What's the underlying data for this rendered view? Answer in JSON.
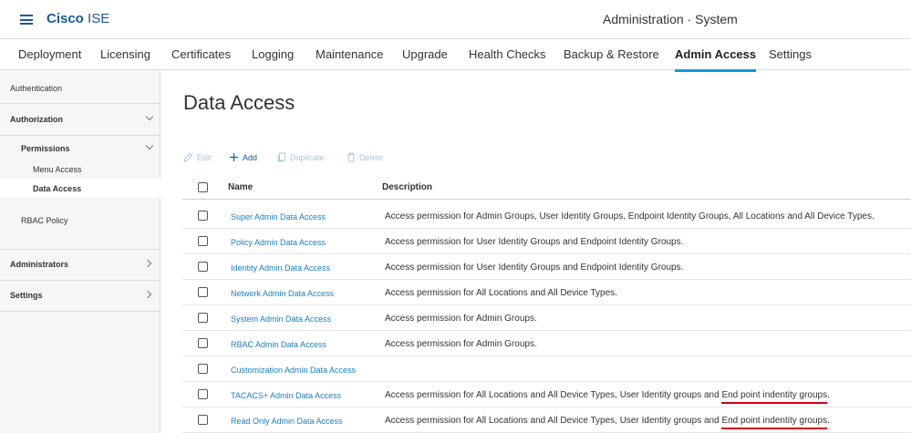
{
  "header": {
    "brand_bold": "Cisco",
    "brand_rest": "ISE",
    "title": "Administration · System"
  },
  "tabs": [
    {
      "label": "Deployment"
    },
    {
      "label": "Licensing"
    },
    {
      "label": "Certificates"
    },
    {
      "label": "Logging"
    },
    {
      "label": "Maintenance"
    },
    {
      "label": "Upgrade"
    },
    {
      "label": "Health Checks"
    },
    {
      "label": "Backup & Restore"
    },
    {
      "label": "Admin Access",
      "active": true
    },
    {
      "label": "Settings"
    }
  ],
  "sidebar": {
    "items": [
      {
        "label": "Authentication"
      },
      {
        "label": "Authorization"
      },
      {
        "label": "Permissions"
      },
      {
        "label": "Menu Access"
      },
      {
        "label": "Data Access",
        "selected": true
      },
      {
        "label": "RBAC Policy"
      },
      {
        "label": "Administrators"
      },
      {
        "label": "Settings"
      }
    ]
  },
  "main": {
    "title": "Data Access",
    "toolbar": {
      "edit": "Edit",
      "add": "Add",
      "duplicate": "Duplicate",
      "delete": "Delete"
    },
    "columns": {
      "name": "Name",
      "description": "Description"
    },
    "rows": [
      {
        "name": "Super Admin Data Access",
        "description": "Access permission for Admin Groups, User Identity Groups, Endpoint Identity Groups, All Locations and All Device Types.",
        "highlight": ""
      },
      {
        "name": "Policy Admin Data Access",
        "description": "Access permission for User Identity Groups and Endpoint Identity Groups.",
        "highlight": ""
      },
      {
        "name": "Identity Admin Data Access",
        "description": "Access permission for User Identity Groups and Endpoint Identity Groups.",
        "highlight": ""
      },
      {
        "name": "Network Admin Data Access",
        "description": "Access permission for All Locations and All Device Types.",
        "highlight": ""
      },
      {
        "name": "System Admin Data Access",
        "description": "Access permission for Admin Groups.",
        "highlight": ""
      },
      {
        "name": "RBAC Admin Data Access",
        "description": "Access permission for Admin Groups.",
        "highlight": ""
      },
      {
        "name": "Customization Admin Data Access",
        "description": "",
        "highlight": ""
      },
      {
        "name": "TACACS+ Admin Data Access",
        "description": "Access permission for All Locations and All Device Types, User Identity groups and ",
        "highlight": "End point indentity groups",
        "suffix": "."
      },
      {
        "name": "Read Only Admin Data Access",
        "description": "Access permission for All Locations and All Device Types, User Identity groups and ",
        "highlight": "End point indentity groups",
        "suffix": "."
      }
    ]
  },
  "colors": {
    "accent": "#049fd9",
    "brand": "#1a5a96",
    "link": "#1a7fbf",
    "annotation": "#d0021b"
  }
}
